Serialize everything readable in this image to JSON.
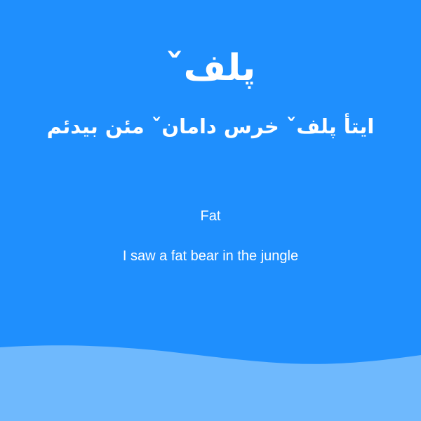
{
  "card": {
    "word": "پلفˇ",
    "sentence": "ایتأ پلفˇ خرس دامانˇ مئن بیدئم",
    "translation_word": "Fat",
    "translation_sentence": "I saw a fat bear in the jungle"
  },
  "colors": {
    "background": "#1f8ffd",
    "wave": "#6fb9fd",
    "text": "#ffffff"
  }
}
